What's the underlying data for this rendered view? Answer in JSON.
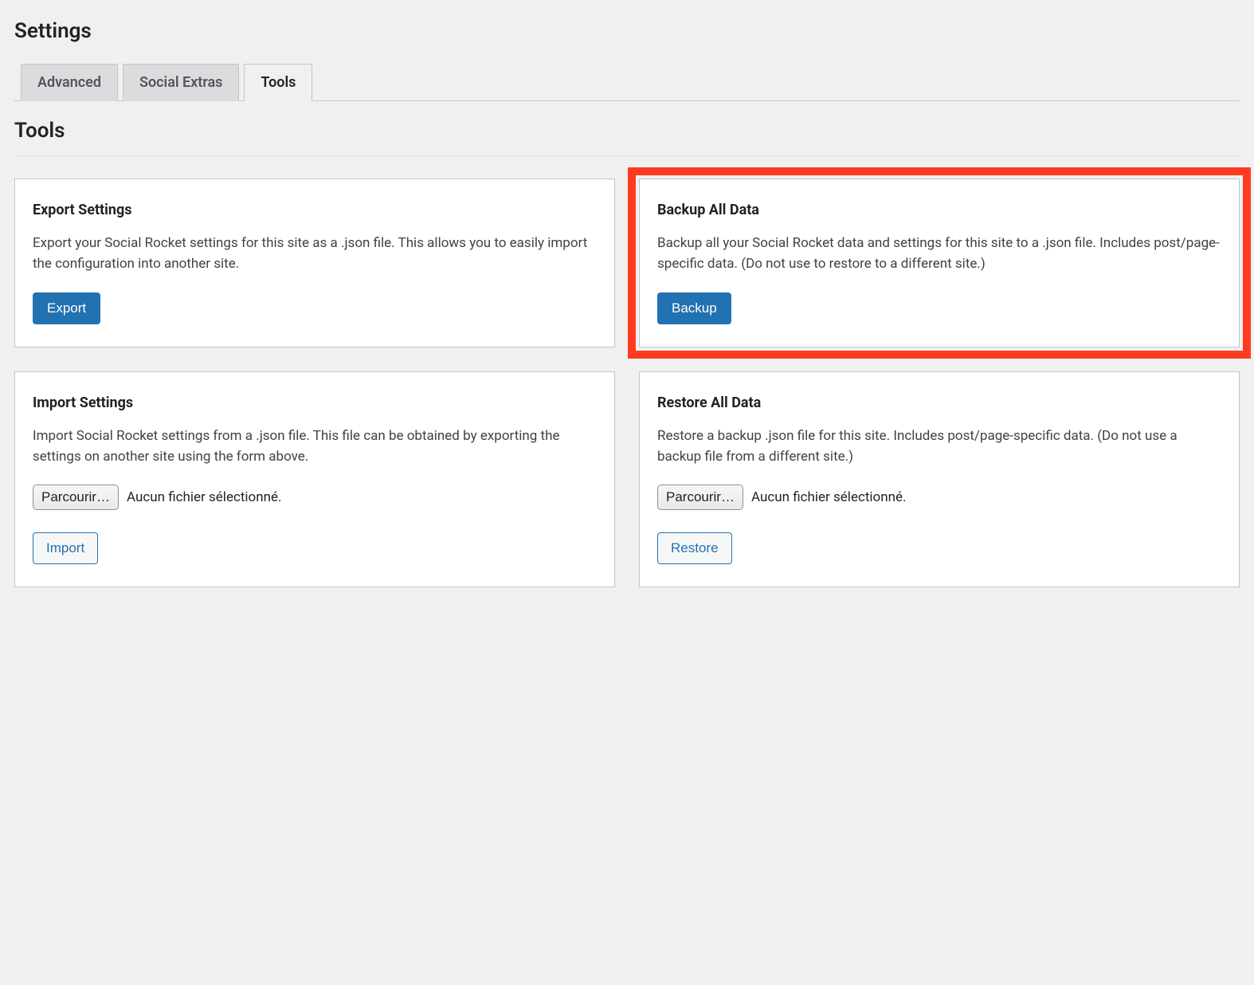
{
  "page": {
    "title": "Settings",
    "section_title": "Tools"
  },
  "tabs": [
    {
      "label": "Advanced",
      "active": false
    },
    {
      "label": "Social Extras",
      "active": false
    },
    {
      "label": "Tools",
      "active": true
    }
  ],
  "cards": {
    "export": {
      "title": "Export Settings",
      "desc": "Export your Social Rocket settings for this site as a .json file. This allows you to easily import the configuration into another site.",
      "button": "Export"
    },
    "backup": {
      "title": "Backup All Data",
      "desc": "Backup all your Social Rocket data and settings for this site to a .json file. Includes post/page-specific data. (Do not use to restore to a different site.)",
      "button": "Backup",
      "highlight": true
    },
    "import": {
      "title": "Import Settings",
      "desc": "Import Social Rocket settings from a .json file. This file can be obtained by exporting the settings on another site using the form above.",
      "file_button": "Parcourir…",
      "file_status": "Aucun fichier sélectionné.",
      "button": "Import"
    },
    "restore": {
      "title": "Restore All Data",
      "desc": "Restore a backup .json file for this site. Includes post/page-specific data. (Do not use a backup file from a different site.)",
      "file_button": "Parcourir…",
      "file_status": "Aucun fichier sélectionné.",
      "button": "Restore"
    }
  }
}
